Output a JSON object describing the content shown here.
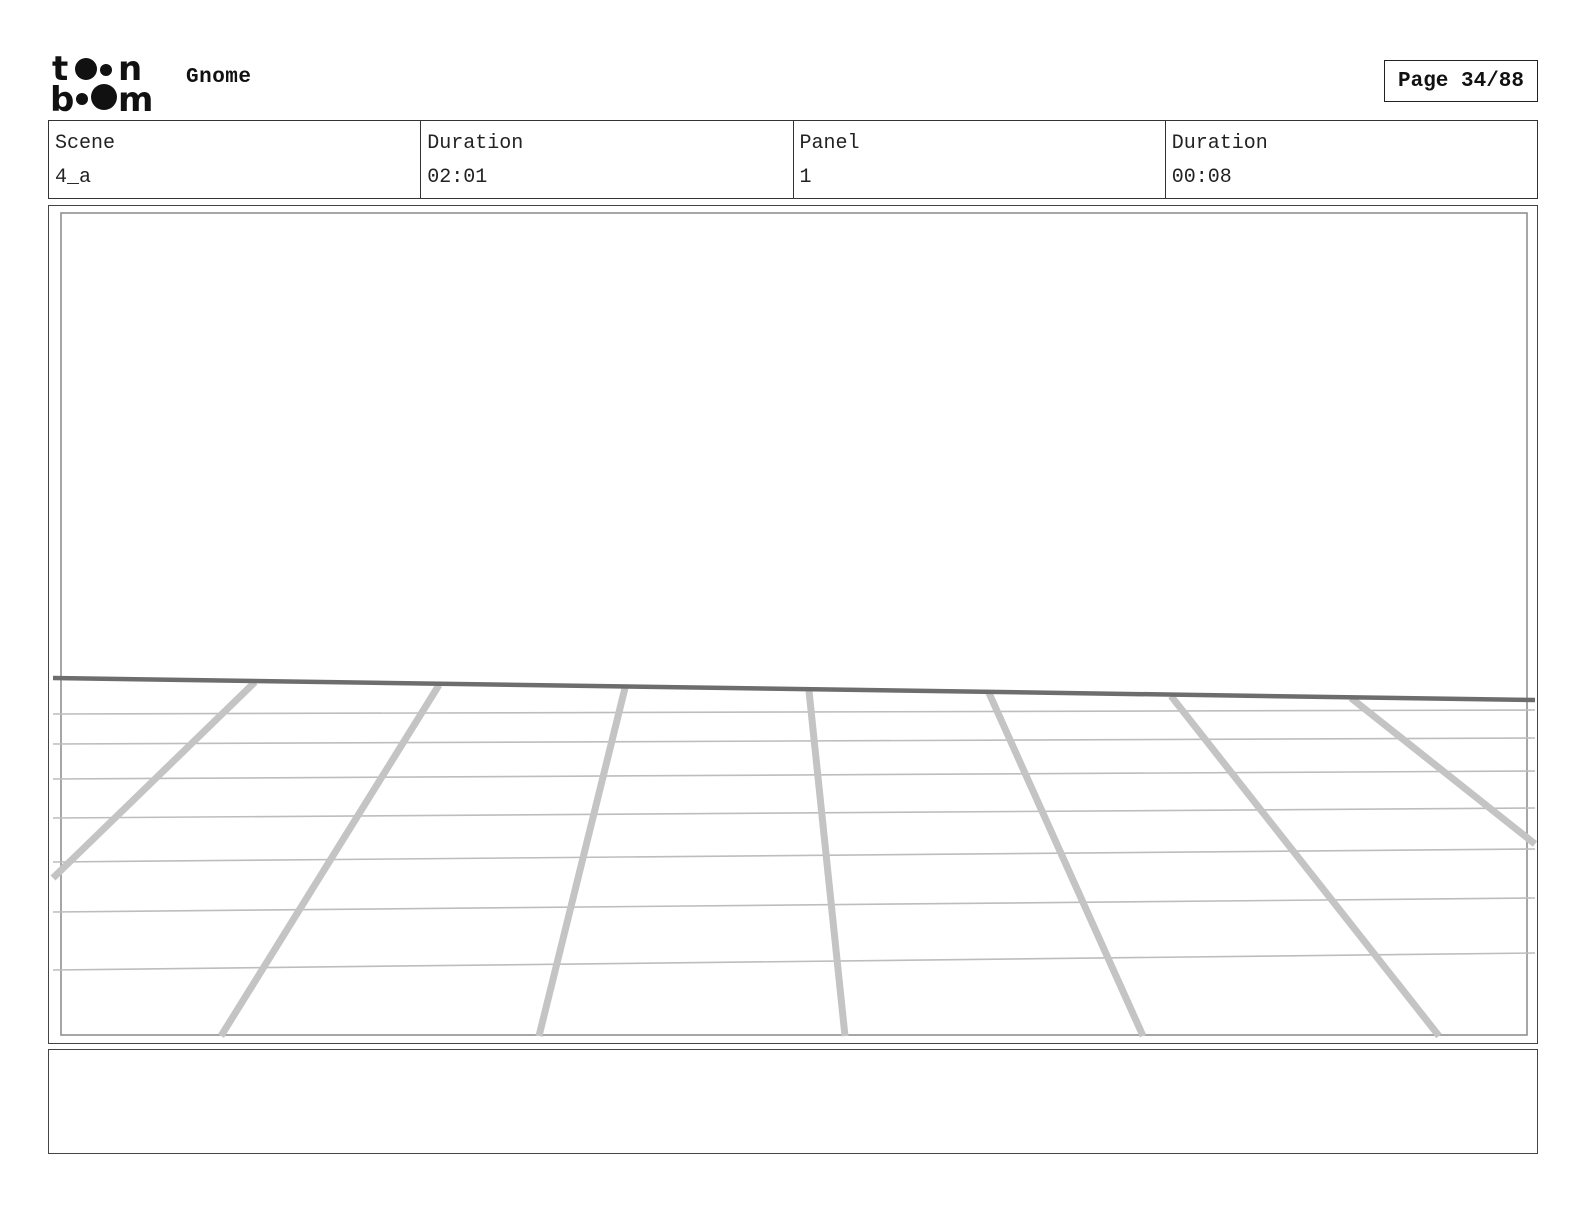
{
  "header": {
    "logo_name": "toon boom",
    "project_title": "Gnome",
    "page_label": "Page 34/88"
  },
  "info": {
    "scene_label": "Scene",
    "scene_value": "4_a",
    "scene_duration_label": "Duration",
    "scene_duration_value": "02:01",
    "panel_label": "Panel",
    "panel_value": "1",
    "panel_duration_label": "Duration",
    "panel_duration_value": "00:08"
  },
  "panel": {
    "drawing": "perspective floor grid"
  },
  "notes": {
    "text": ""
  }
}
